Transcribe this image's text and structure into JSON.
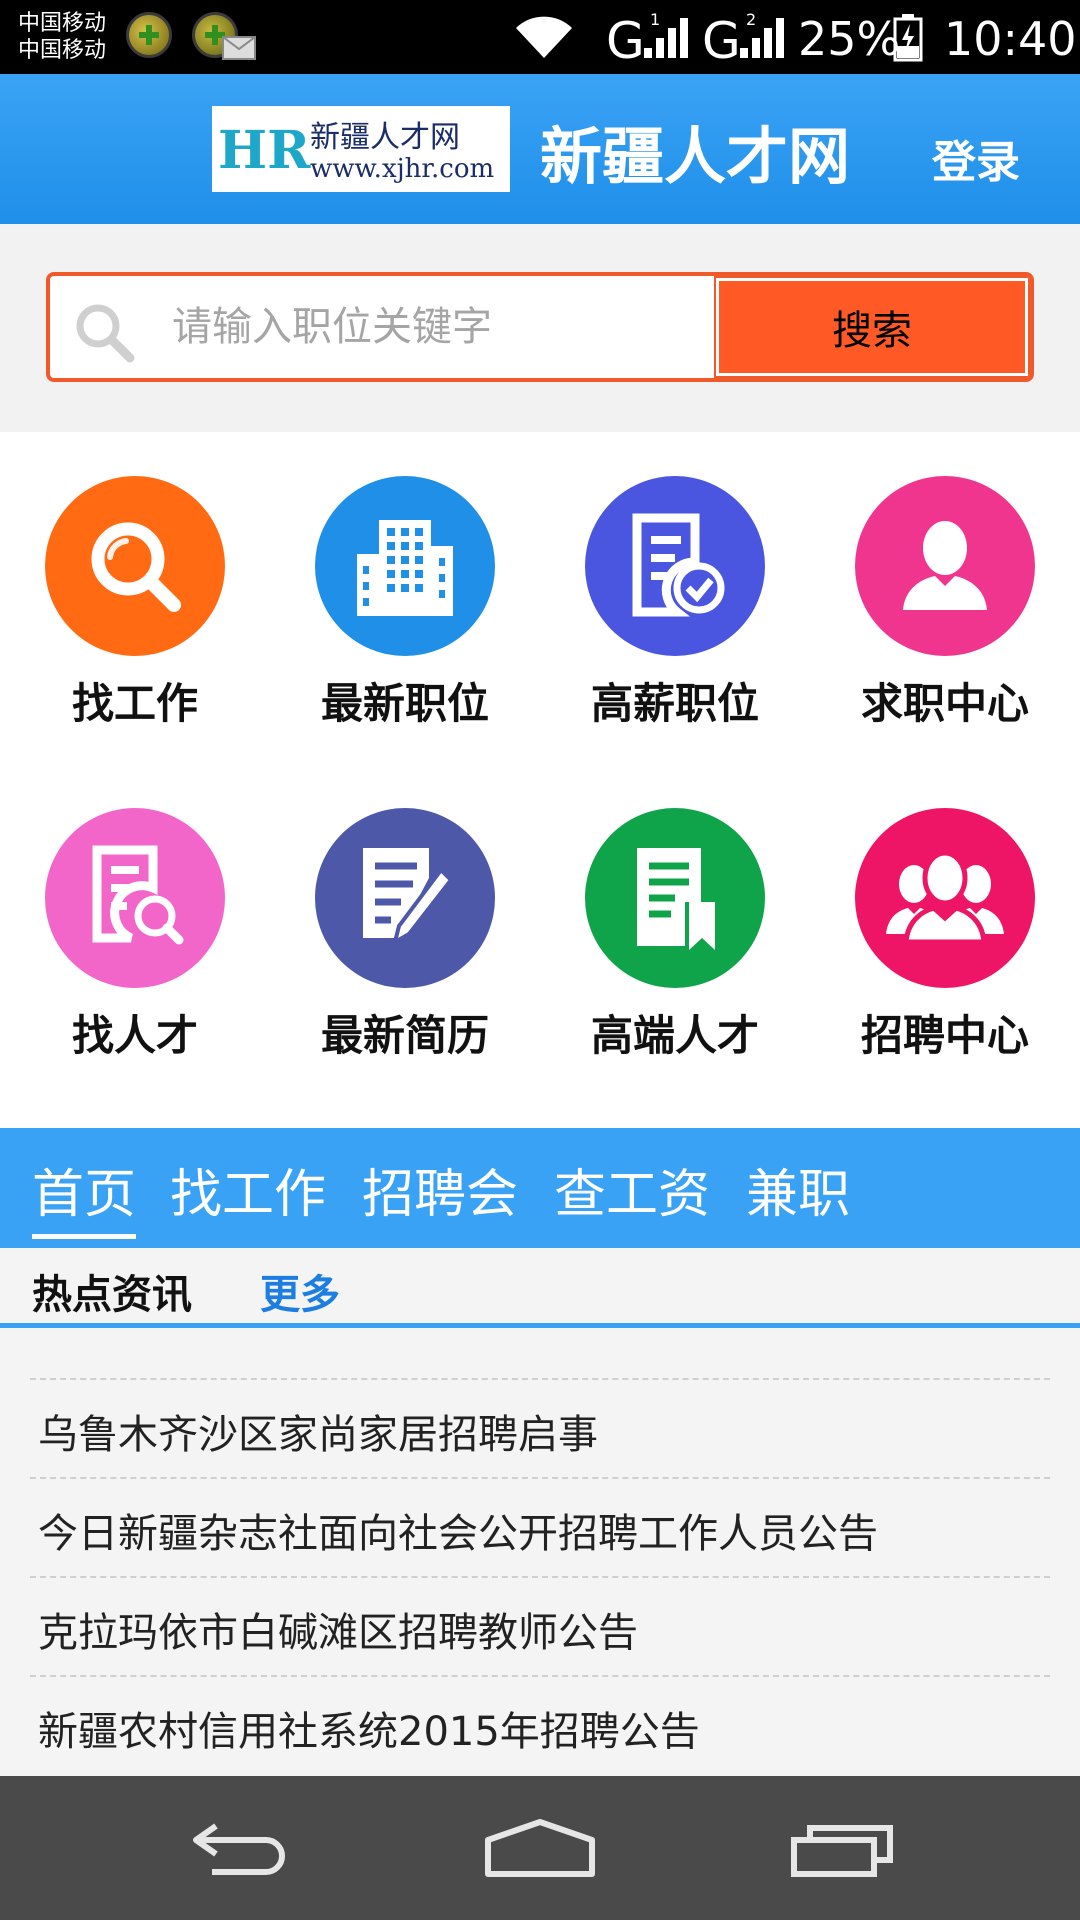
{
  "status_bar": {
    "carrier_1": "中国移动",
    "carrier_2": "中国移动",
    "signal_1": "1",
    "signal_2": "2",
    "battery": "25%",
    "time": "10:40"
  },
  "header": {
    "logo_mark": "HR",
    "logo_name": "新疆人才网",
    "logo_url": "www.xjhr.com",
    "title": "新疆人才网",
    "login": "登录"
  },
  "search": {
    "placeholder": "请输入职位关键字",
    "button": "搜索"
  },
  "grid": [
    {
      "label": "找工作",
      "icon": "magnifier-icon",
      "color": "#ff6a13"
    },
    {
      "label": "最新职位",
      "icon": "building-icon",
      "color": "#1f8fe8"
    },
    {
      "label": "高薪职位",
      "icon": "document-check-icon",
      "color": "#4a55e0"
    },
    {
      "label": "求职中心",
      "icon": "person-icon",
      "color": "#f0358f"
    },
    {
      "label": "找人才",
      "icon": "document-search-icon",
      "color": "#f266c9"
    },
    {
      "label": "最新简历",
      "icon": "document-pen-icon",
      "color": "#4d58a8"
    },
    {
      "label": "高端人才",
      "icon": "document-bookmark-icon",
      "color": "#0fa34a"
    },
    {
      "label": "招聘中心",
      "icon": "people-group-icon",
      "color": "#ee1466"
    }
  ],
  "tabs": [
    "首页",
    "找工作",
    "招聘会",
    "查工资",
    "兼职"
  ],
  "news": {
    "title": "热点资讯",
    "more": "更多",
    "items": [
      "乌鲁木齐沙区家尚家居招聘启事",
      "今日新疆杂志社面向社会公开招聘工作人员公告",
      "克拉玛依市白碱滩区招聘教师公告",
      "新疆农村信用社系统2015年招聘公告"
    ]
  },
  "colors": {
    "header_blue": "#1f8fe9",
    "search_orange": "#ff5a26",
    "tab_blue": "#3aa2f5"
  }
}
